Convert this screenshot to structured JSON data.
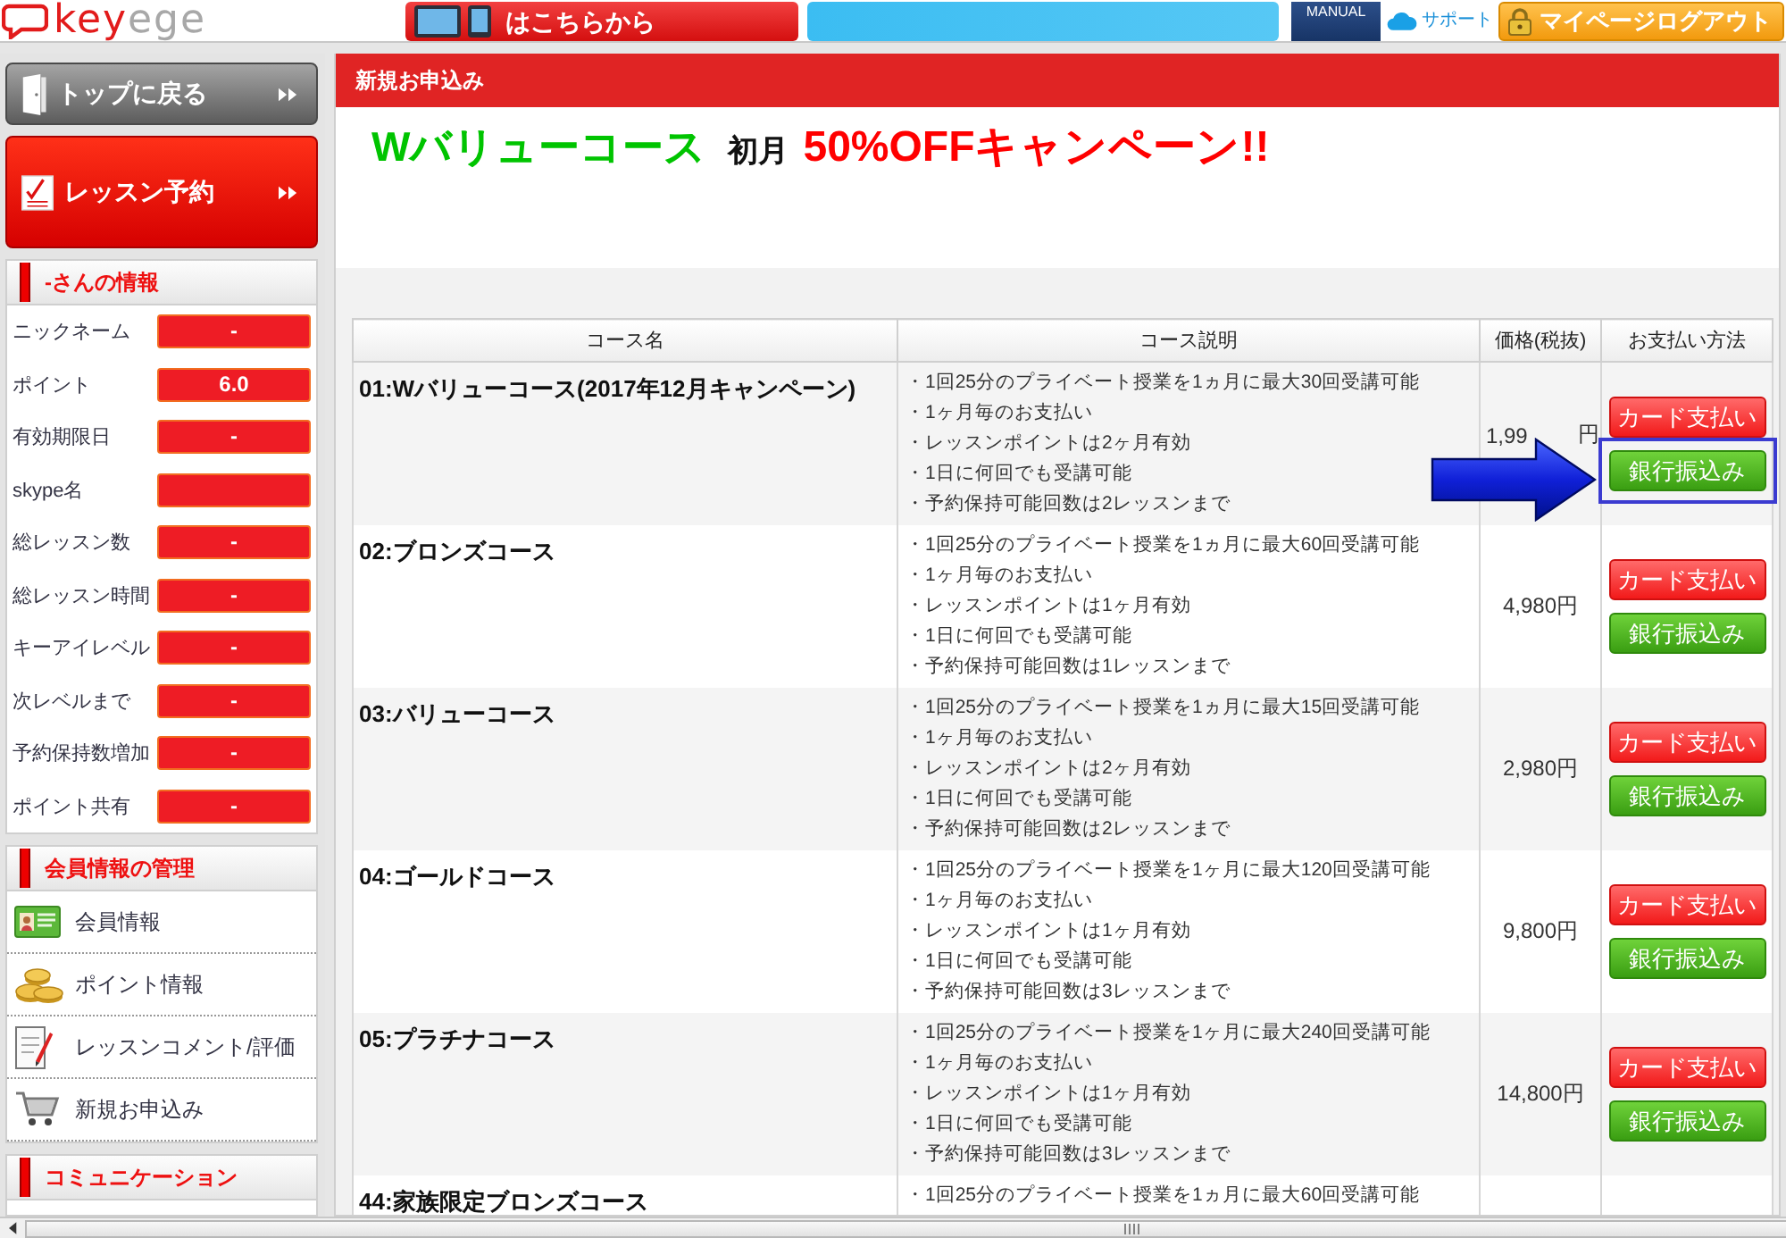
{
  "header": {
    "logo": {
      "accent": "key",
      "rest": "ege"
    },
    "banner_text": "はこちらから",
    "manual_label": "MANUAL",
    "support_label": "サポート",
    "logout_button": "マイページログアウト"
  },
  "sidebar": {
    "buttons": [
      {
        "kind": "home",
        "label": "トップに戻る"
      },
      {
        "kind": "reserve",
        "label": "レッスン予約"
      }
    ],
    "sections": [
      {
        "kind": "info",
        "title": "-さんの情報",
        "rows": [
          {
            "label": "ニックネーム",
            "value": "-"
          },
          {
            "label": "ポイント",
            "value": "6.0"
          },
          {
            "label": "有効期限日",
            "value": "-"
          },
          {
            "label": "skype名"
          },
          {
            "label": "総レッスン数",
            "value": "-"
          },
          {
            "label": "総レッスン時間",
            "value": "-"
          },
          {
            "label": "キーアイレベル",
            "value": "-"
          },
          {
            "label": "次レベルまで",
            "value": "-"
          },
          {
            "label": "予約保持数増加",
            "value": "-"
          },
          {
            "label": "ポイント共有",
            "value": "-"
          }
        ]
      },
      {
        "kind": "menu",
        "title": "会員情報の管理",
        "items": [
          {
            "kind": "profile",
            "label": "会員情報"
          },
          {
            "kind": "points",
            "label": "ポイント情報"
          },
          {
            "kind": "review",
            "label": "レッスンコメント/評価"
          },
          {
            "kind": "order",
            "label": "新規お申込み"
          }
        ]
      },
      {
        "kind": "menu",
        "title": "コミュニケーション"
      }
    ]
  },
  "page": {
    "title": "新規お申込み",
    "headline": {
      "course": "Wバリューコース",
      "prefix": "初月",
      "offer": "50%OFFキャンペーン!!"
    }
  },
  "table": {
    "columns": [
      "コース名",
      "コース説明",
      "価格(税抜)",
      "お支払い方法"
    ],
    "rows": [
      {
        "name": "01:Wバリューコース(2017年12月キャンペーン)",
        "details": [
          "・1回25分のプライベート授業を1ヵ月に最大30回受講可能",
          "・1ヶ月毎のお支払い",
          "・レッスンポイントは2ヶ月有効",
          "・1日に何回でも受講可能",
          "・予約保持可能回数は2レッスンまで"
        ],
        "price": "1,99",
        "price_tail": "円",
        "buttons": [
          {
            "kind": "card",
            "label": "カード支払い",
            "highlighted": false
          },
          {
            "kind": "bank",
            "label": "銀行振込み",
            "highlighted": true
          }
        ]
      },
      {
        "name": "02:ブロンズコース",
        "details": [
          "・1回25分のプライベート授業を1ヵ月に最大60回受講可能",
          "・1ヶ月毎のお支払い",
          "・レッスンポイントは1ヶ月有効",
          "・1日に何回でも受講可能",
          "・予約保持可能回数は1レッスンまで"
        ],
        "price": "4,980円",
        "buttons": [
          {
            "kind": "card",
            "label": "カード支払い",
            "highlighted": false
          },
          {
            "kind": "bank",
            "label": "銀行振込み",
            "highlighted": false
          }
        ]
      },
      {
        "name": "03:バリューコース",
        "details": [
          "・1回25分のプライベート授業を1ヵ月に最大15回受講可能",
          "・1ヶ月毎のお支払い",
          "・レッスンポイントは2ヶ月有効",
          "・1日に何回でも受講可能",
          "・予約保持可能回数は2レッスンまで"
        ],
        "price": "2,980円",
        "buttons": [
          {
            "kind": "card",
            "label": "カード支払い",
            "highlighted": false
          },
          {
            "kind": "bank",
            "label": "銀行振込み",
            "highlighted": false
          }
        ]
      },
      {
        "name": "04:ゴールドコース",
        "details": [
          "・1回25分のプライベート授業を1ヶ月に最大120回受講可能",
          "・1ヶ月毎のお支払い",
          "・レッスンポイントは1ヶ月有効",
          "・1日に何回でも受講可能",
          "・予約保持可能回数は3レッスンまで"
        ],
        "price": "9,800円",
        "buttons": [
          {
            "kind": "card",
            "label": "カード支払い",
            "highlighted": false
          },
          {
            "kind": "bank",
            "label": "銀行振込み",
            "highlighted": false
          }
        ]
      },
      {
        "name": "05:プラチナコース",
        "details": [
          "・1回25分のプライベート授業を1ヶ月に最大240回受講可能",
          "・1ヶ月毎のお支払い",
          "・レッスンポイントは1ヶ月有効",
          "・1日に何回でも受講可能",
          "・予約保持可能回数は3レッスンまで"
        ],
        "price": "14,800円",
        "buttons": [
          {
            "kind": "card",
            "label": "カード支払い",
            "highlighted": false
          },
          {
            "kind": "bank",
            "label": "銀行振込み",
            "highlighted": false
          }
        ]
      },
      {
        "name": "44:家族限定ブロンズコース",
        "details": [
          "・1回25分のプライベート授業を1ヵ月に最大60回受講可能"
        ]
      }
    ]
  }
}
